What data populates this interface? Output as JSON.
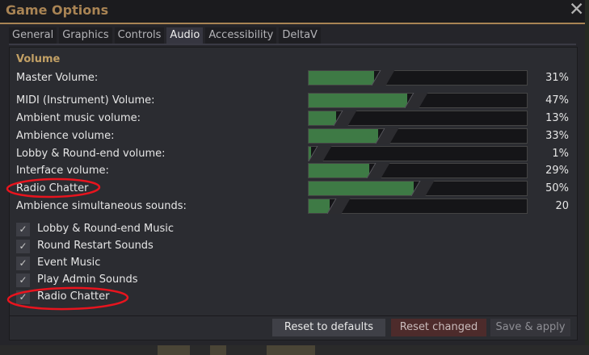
{
  "window": {
    "title": "Game Options"
  },
  "tabs": [
    {
      "label": "General"
    },
    {
      "label": "Graphics"
    },
    {
      "label": "Controls"
    },
    {
      "label": "Audio"
    },
    {
      "label": "Accessibility"
    },
    {
      "label": "DeltaV"
    }
  ],
  "active_tab": "Audio",
  "audio": {
    "section_title": "Volume",
    "sliders": [
      {
        "label": "Master Volume:",
        "value": "31%",
        "level": 0.31
      },
      {
        "label": "MIDI (Instrument) Volume:",
        "value": "47%",
        "level": 0.47
      },
      {
        "label": "Ambient music volume:",
        "value": "13%",
        "level": 0.13
      },
      {
        "label": "Ambience volume:",
        "value": "33%",
        "level": 0.33
      },
      {
        "label": "Lobby & Round-end volume:",
        "value": "1%",
        "level": 0.01
      },
      {
        "label": "Interface volume:",
        "value": "29%",
        "level": 0.29
      },
      {
        "label": "Radio Chatter",
        "value": "50%",
        "level": 0.5
      },
      {
        "label": "Ambience simultaneous sounds:",
        "value": "20",
        "level": 0.1
      }
    ],
    "checkboxes": [
      {
        "label": "Lobby & Round-end Music",
        "checked": true
      },
      {
        "label": "Round Restart Sounds",
        "checked": true
      },
      {
        "label": "Event Music",
        "checked": true
      },
      {
        "label": "Play Admin Sounds",
        "checked": true
      },
      {
        "label": "Radio Chatter",
        "checked": true
      }
    ]
  },
  "buttons": {
    "reset_defaults": "Reset to defaults",
    "reset_changed": "Reset changed",
    "save_apply": "Save & apply"
  },
  "icons": {
    "close": "close-icon",
    "check": "checkmark-icon"
  },
  "colors": {
    "title": "#a98454",
    "section": "#c2a065",
    "slider_fill": "#3e7a45",
    "annotation": "#e8141e"
  }
}
